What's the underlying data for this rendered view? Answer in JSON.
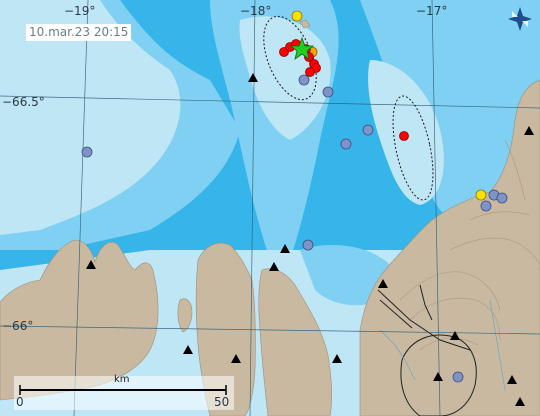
{
  "timestamp": "10.mar.23  20:15",
  "longitude_labels": [
    "−19°",
    "−18°",
    "−17°"
  ],
  "latitude_labels": [
    "−66.5°",
    "−66°"
  ],
  "scale_bar": {
    "start": "0",
    "unit": "km",
    "end": "50"
  },
  "logo_icon": "star-compass-icon",
  "colors": {
    "sea_deep": "#36b5ea",
    "sea_mid": "#7fd0f2",
    "sea_shallow": "#bfe6f5",
    "land": "#c8b9a0",
    "earthquake_recent": "#ff0000",
    "earthquake_hours": "#ffa500",
    "earthquake_day": "#ffe000",
    "earthquake_old": "#7f93c8",
    "largest_event": "#22cc22",
    "station": "#000000"
  }
}
